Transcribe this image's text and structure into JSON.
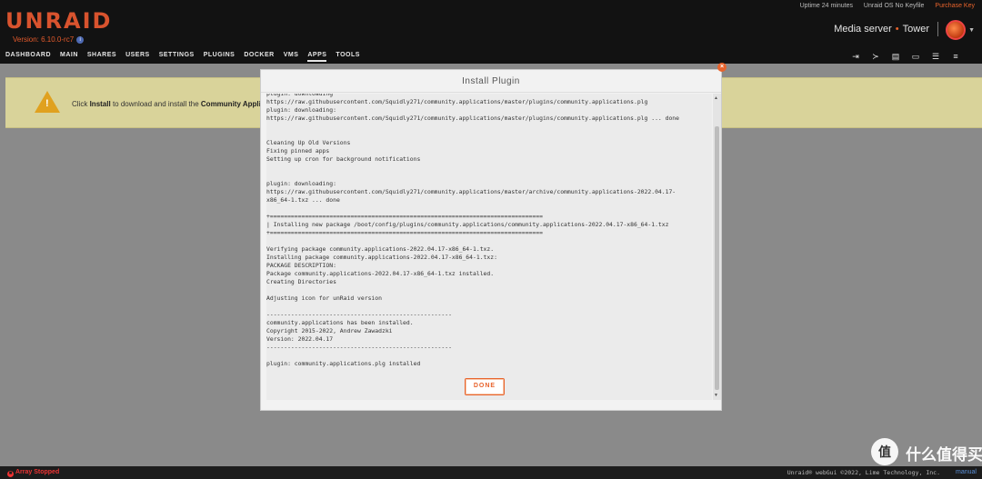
{
  "header": {
    "logo": "UNRAID",
    "version": "Version: 6.10.0-rc7",
    "uptime": "Uptime 24 minutes",
    "os_status": "Unraid OS No Keyfile",
    "purchase": "Purchase Key",
    "server_name": "Media server",
    "server_host": "Tower",
    "nav": [
      "DASHBOARD",
      "MAIN",
      "SHARES",
      "USERS",
      "SETTINGS",
      "PLUGINS",
      "DOCKER",
      "VMS",
      "APPS",
      "TOOLS"
    ],
    "active_nav": "APPS",
    "nav_icons": [
      "logout-icon",
      "terminal-icon",
      "feedback-icon",
      "display-icon",
      "log-icon",
      "menu-icon"
    ]
  },
  "notice": {
    "text_prefix": "Click",
    "text_bold": "Install",
    "text_middle": "to download and install the",
    "text_bold2": "Community Applic"
  },
  "modal": {
    "title": "Install Plugin",
    "done_label": "DONE",
    "log_lines": [
      "plugin: downloading",
      "https://raw.githubusercontent.com/Squidly271/community.applications/master/plugins/community.applications.plg",
      "plugin: downloading:",
      "https://raw.githubusercontent.com/Squidly271/community.applications/master/plugins/community.applications.plg ... done",
      "",
      "",
      "Cleaning Up Old Versions",
      "Fixing pinned apps",
      "Setting up cron for background notifications",
      "",
      "",
      "plugin: downloading:",
      "https://raw.githubusercontent.com/Squidly271/community.applications/master/archive/community.applications-2022.04.17-",
      "x86_64-1.txz ... done",
      "",
      "+==============================================================================",
      "| Installing new package /boot/config/plugins/community.applications/community.applications-2022.04.17-x86_64-1.txz",
      "+==============================================================================",
      "",
      "Verifying package community.applications-2022.04.17-x86_64-1.txz.",
      "Installing package community.applications-2022.04.17-x86_64-1.txz:",
      "PACKAGE DESCRIPTION:",
      "Package community.applications-2022.04.17-x86_64-1.txz installed.",
      "Creating Directories",
      "",
      "Adjusting icon for unRaid version",
      "",
      "-----------------------------------------------------",
      "community.applications has been installed.",
      "Copyright 2015-2022, Andrew Zawadzki",
      "Version: 2022.04.17",
      "-----------------------------------------------------",
      "",
      "plugin: community.applications.plg installed"
    ]
  },
  "footer": {
    "array_status": "Array Stopped",
    "copyright": "Unraid® webGui ©2022, Lime Technology, Inc.",
    "manual": "manual"
  },
  "watermark": {
    "seal": "值",
    "text": "什么值得买"
  }
}
